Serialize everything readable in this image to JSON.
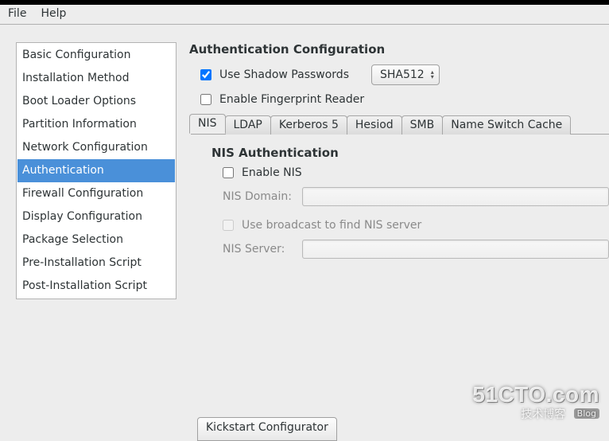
{
  "menubar": {
    "file": "File",
    "help": "Help"
  },
  "sidebar": {
    "items": [
      {
        "label": "Basic Configuration"
      },
      {
        "label": "Installation Method"
      },
      {
        "label": "Boot Loader Options"
      },
      {
        "label": "Partition Information"
      },
      {
        "label": "Network Configuration"
      },
      {
        "label": "Authentication"
      },
      {
        "label": "Firewall Configuration"
      },
      {
        "label": "Display Configuration"
      },
      {
        "label": "Package Selection"
      },
      {
        "label": "Pre-Installation Script"
      },
      {
        "label": "Post-Installation Script"
      }
    ],
    "selected_index": 5
  },
  "panel": {
    "title": "Authentication Configuration",
    "use_shadow_label": "Use Shadow Passwords",
    "use_shadow_checked": true,
    "hash_algo": "SHA512",
    "enable_fp_label": "Enable Fingerprint Reader",
    "enable_fp_checked": false,
    "tabs": [
      {
        "label": "NIS"
      },
      {
        "label": "LDAP"
      },
      {
        "label": "Kerberos 5"
      },
      {
        "label": "Hesiod"
      },
      {
        "label": "SMB"
      },
      {
        "label": "Name Switch Cache"
      }
    ],
    "active_tab_index": 0,
    "nis": {
      "group_title": "NIS Authentication",
      "enable_label": "Enable NIS",
      "enable_checked": false,
      "domain_label": "NIS Domain:",
      "domain_value": "",
      "broadcast_label": "Use broadcast to find NIS server",
      "broadcast_checked": false,
      "server_label": "NIS Server:",
      "server_value": ""
    }
  },
  "bottom_button": "Kickstart Configurator",
  "watermark": {
    "line1": "51CTO.com",
    "line2": "技术博客",
    "badge": "Blog"
  }
}
